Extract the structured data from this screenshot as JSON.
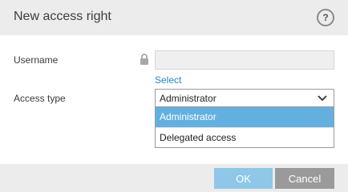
{
  "dialog": {
    "title": "New access right",
    "help_icon": "question-mark-icon",
    "help_label": "?"
  },
  "form": {
    "username": {
      "label": "Username",
      "value": "",
      "lock_icon": "lock-icon",
      "select_link": "Select"
    },
    "access_type": {
      "label": "Access type",
      "selected": "Administrator",
      "chevron_icon": "chevron-down-icon",
      "options": [
        "Administrator",
        "Delegated access"
      ],
      "highlighted_option": "Administrator"
    }
  },
  "footer": {
    "ok_label": "OK",
    "cancel_label": "Cancel"
  },
  "colors": {
    "header_bg": "#ececec",
    "link": "#2a87c0",
    "highlight": "#63b0e0",
    "ok_button": "#8fc7e9",
    "cancel_button": "#9a9a9a"
  }
}
